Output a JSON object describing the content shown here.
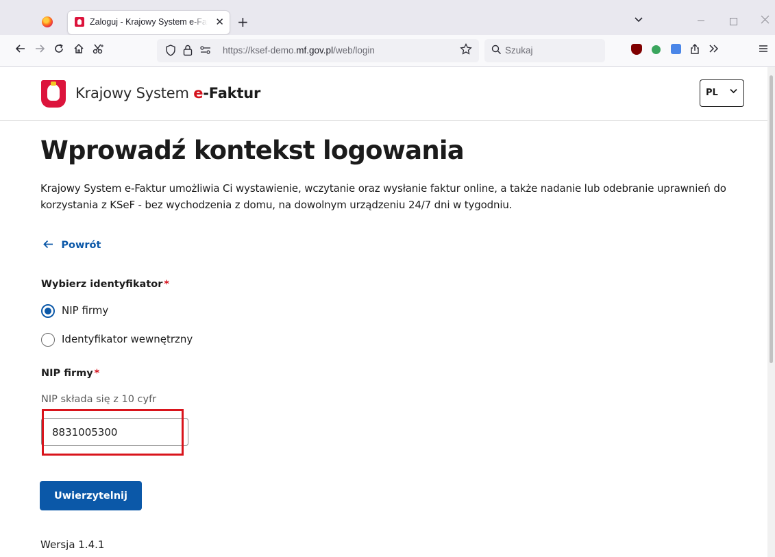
{
  "browser": {
    "tab_title": "Zaloguj - Krajowy System e-Faktur",
    "tab_close": "✕",
    "new_tab": "+",
    "url_prefix": "https://ksef-demo.",
    "url_domain": "mf.gov.pl",
    "url_path": "/web/login",
    "search_placeholder": "Szukaj"
  },
  "header": {
    "brand_prefix": "Krajowy System",
    "brand_e": "e",
    "brand_rest": "-Faktur",
    "language": "PL"
  },
  "main": {
    "title": "Wprowadź kontekst logowania",
    "lead": "Krajowy System e-Faktur umożliwia Ci wystawienie, wczytanie oraz wysłanie faktur online, a także nadanie lub odebranie uprawnień do korzystania z KSeF - bez wychodzenia z domu, na dowolnym urządzeniu 24/7 dni w tygodniu.",
    "back_label": "Powrót",
    "identifier_label": "Wybierz identyfikator",
    "required_mark": "*",
    "options": [
      {
        "label": "NIP firmy",
        "checked": true
      },
      {
        "label": "Identyfikator wewnętrzny",
        "checked": false
      }
    ],
    "nip_label": "NIP firmy",
    "nip_hint": "NIP składa się z 10 cyfr",
    "nip_value": "8831005300",
    "submit_label": "Uwierzytelnij",
    "version": "Wersja 1.4.1"
  },
  "colors": {
    "primary": "#0b58a8",
    "required": "#d4111c",
    "highlight": "#d9141c"
  }
}
